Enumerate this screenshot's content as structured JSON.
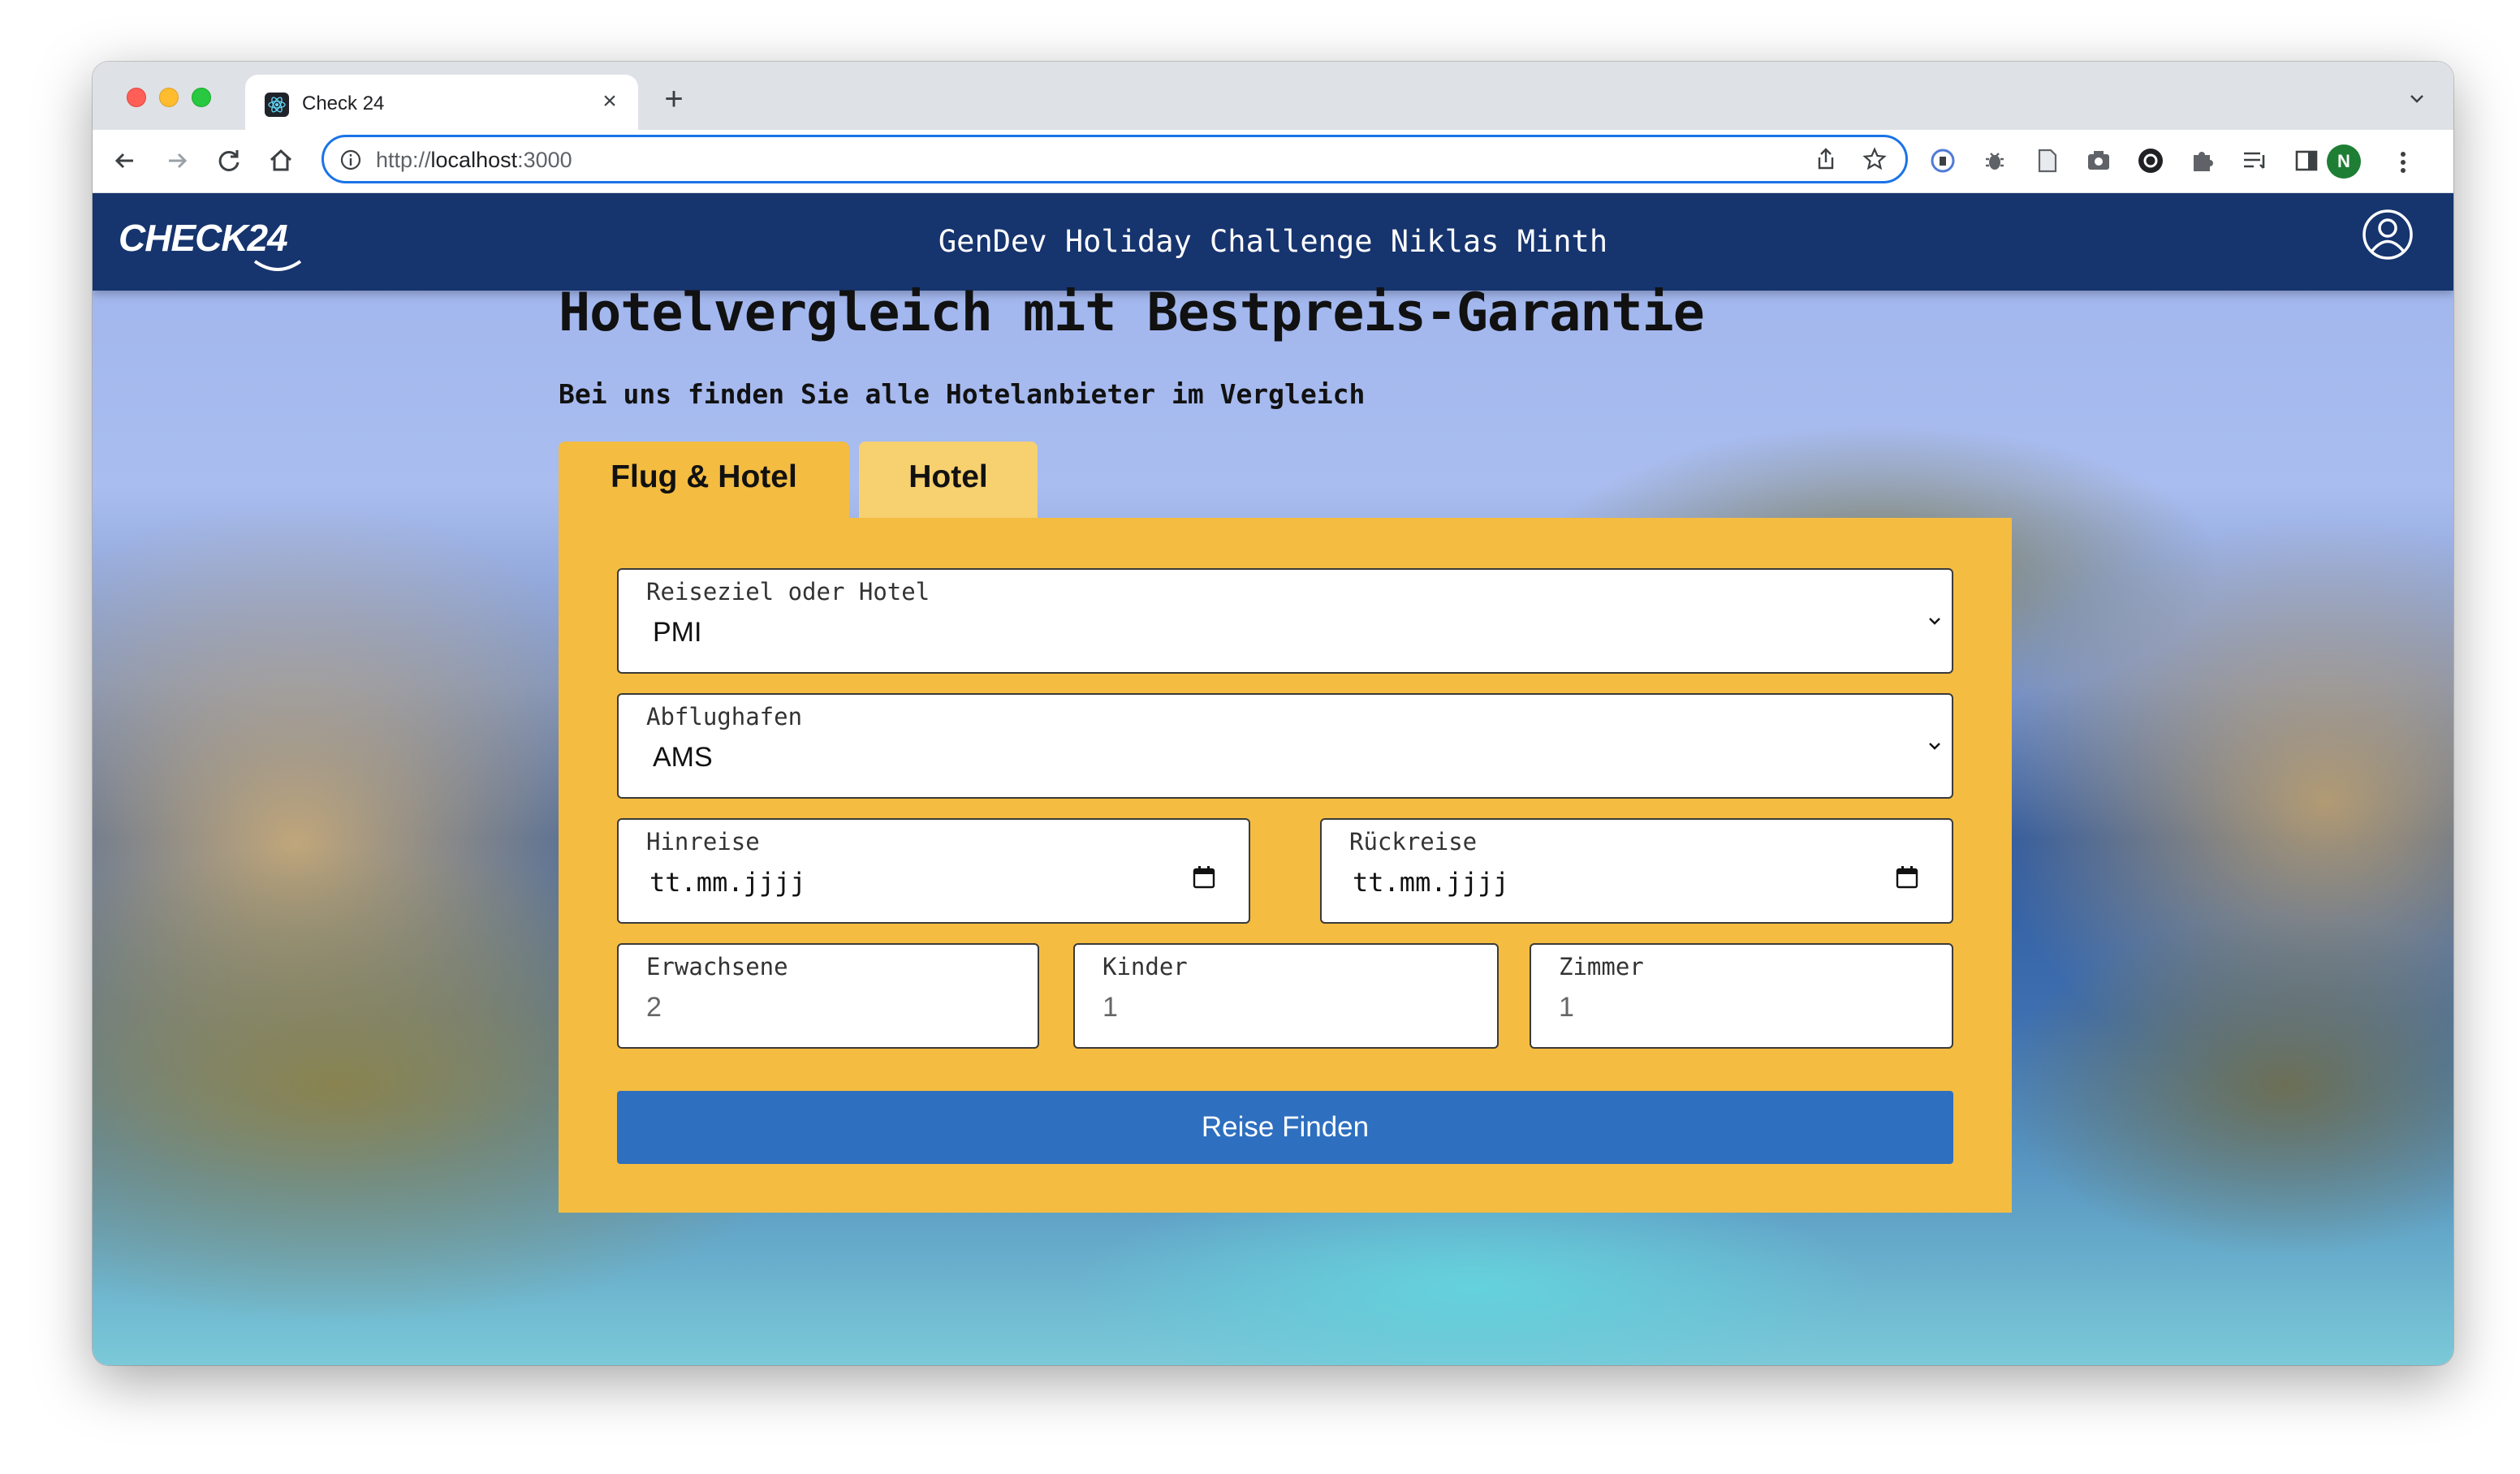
{
  "browser": {
    "tab_title": "Check 24",
    "tab_close": "×",
    "new_tab": "+",
    "url_prefix": "http://",
    "url_host": "localhost",
    "url_rest": ":3000",
    "profile_initial": "N"
  },
  "header": {
    "logo": "CHECK24",
    "title": "GenDev Holiday Challenge Niklas Minth"
  },
  "hero": {
    "headline": "Hotelvergleich mit Bestpreis-Garantie",
    "subline": "Bei uns finden Sie alle Hotelanbieter im Vergleich"
  },
  "tabs": [
    {
      "label": "Flug & Hotel"
    },
    {
      "label": "Hotel"
    }
  ],
  "form": {
    "destination": {
      "label": "Reiseziel oder Hotel",
      "value": "PMI"
    },
    "airport": {
      "label": "Abflughafen",
      "value": "AMS"
    },
    "outbound": {
      "label": "Hinreise",
      "placeholder": "tt.mm.jjjj"
    },
    "return": {
      "label": "Rückreise",
      "placeholder": "tt.mm.jjjj"
    },
    "adults": {
      "label": "Erwachsene",
      "value": "2"
    },
    "children": {
      "label": "Kinder",
      "value": "1"
    },
    "rooms": {
      "label": "Zimmer",
      "value": "1"
    },
    "submit_label": "Reise Finden"
  },
  "colors": {
    "header_bg": "#16346e",
    "panel_bg": "#f4bc41",
    "inactive_tab_bg": "#f7d06f",
    "button_bg": "#2e6fbf"
  }
}
